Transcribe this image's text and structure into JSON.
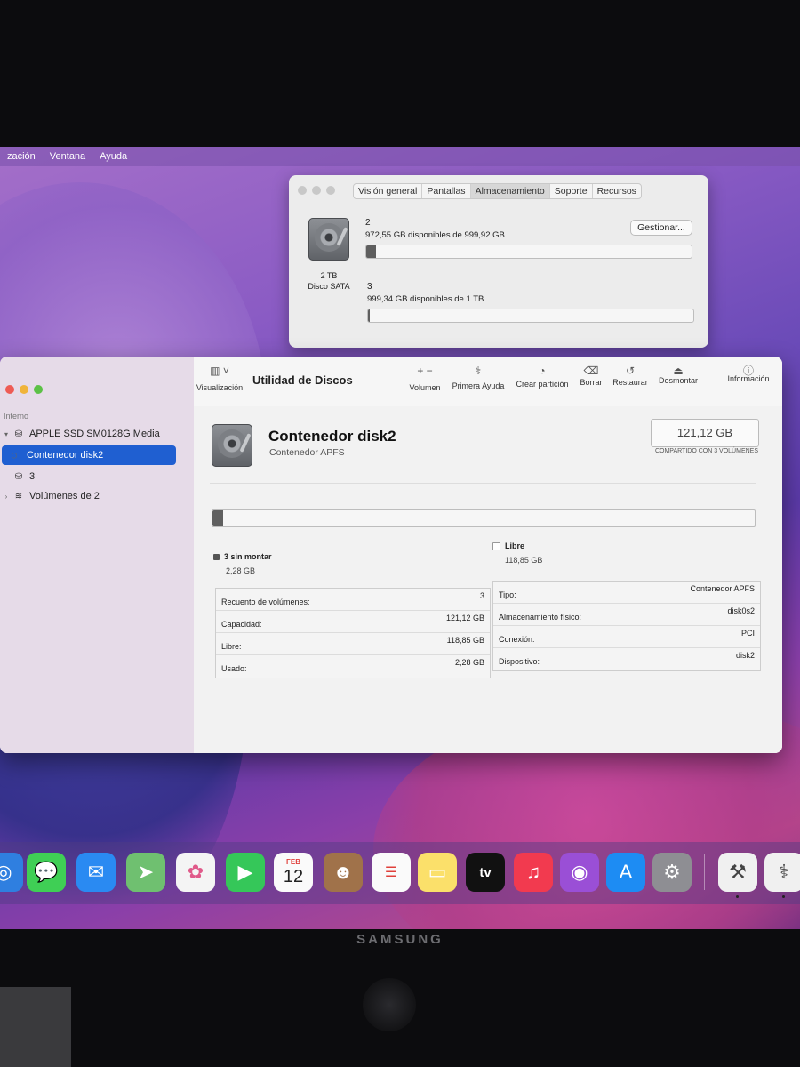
{
  "menubar": {
    "items": [
      "zación",
      "Ventana",
      "Ayuda"
    ]
  },
  "info_window": {
    "tabs": [
      "Visión general",
      "Pantallas",
      "Almacenamiento",
      "Soporte",
      "Recursos"
    ],
    "active_tab": "Almacenamiento",
    "disk_size": "2 TB",
    "disk_type": "Disco SATA",
    "manage_button": "Gestionar...",
    "volumes": [
      {
        "name": "2",
        "detail": "972,55 GB disponibles de 999,92 GB",
        "used_fraction": 0.03
      },
      {
        "name": "3",
        "detail": "999,34 GB disponibles de 1 TB",
        "used_fraction": 0.005
      }
    ]
  },
  "disk_utility": {
    "sidebar": {
      "section": "Interno",
      "items": [
        {
          "label": "APPLE SSD SM0128G Media"
        },
        {
          "label": "Contenedor disk2"
        },
        {
          "label": "3"
        },
        {
          "label": "Volúmenes de 2"
        }
      ]
    },
    "toolbar": {
      "view_label": "Visualización",
      "title": "Utilidad de Discos",
      "volume": "Volumen",
      "first_aid": "Primera Ayuda",
      "partition": "Crear partición",
      "erase": "Borrar",
      "restore": "Restaurar",
      "unmount": "Desmontar",
      "info": "Información"
    },
    "header": {
      "name": "Contenedor disk2",
      "subtitle": "Contenedor APFS",
      "capacity": "121,12 GB",
      "shared": "COMPARTIDO CON 3 VOLÚMENES"
    },
    "usage": {
      "used_fraction": 0.019,
      "used_label": "3 sin montar",
      "used_value": "2,28 GB",
      "free_label": "Libre",
      "free_value": "118,85 GB"
    },
    "table_left": [
      {
        "key": "Recuento de volúmenes:",
        "value": "3"
      },
      {
        "key": "Capacidad:",
        "value": "121,12 GB"
      },
      {
        "key": "Libre:",
        "value": "118,85 GB"
      },
      {
        "key": "Usado:",
        "value": "2,28 GB"
      }
    ],
    "table_right": [
      {
        "key": "Tipo:",
        "value": "Contenedor APFS"
      },
      {
        "key": "Almacenamiento físico:",
        "value": "disk0s2"
      },
      {
        "key": "Conexión:",
        "value": "PCI"
      },
      {
        "key": "Dispositivo:",
        "value": "disk2"
      }
    ]
  },
  "dock": {
    "calendar_month": "FEB",
    "calendar_day": "12",
    "tv_label": "tv"
  },
  "monitor": {
    "brand": "SAMSUNG"
  }
}
